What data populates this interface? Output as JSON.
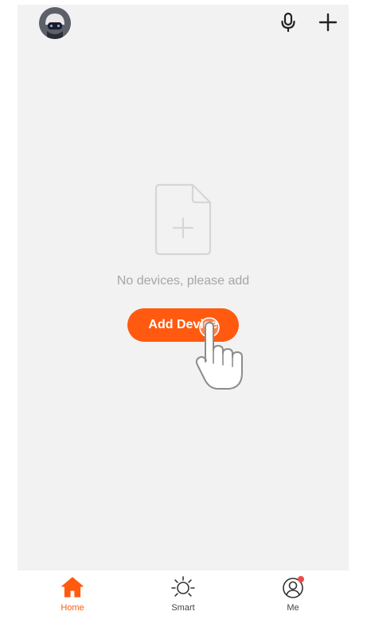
{
  "colors": {
    "accent": "#ff5a0f",
    "background": "#f2f2f2",
    "text_muted": "#a6a6a6",
    "badge": "#f04848"
  },
  "header": {
    "avatar_icon": "avatar-icon",
    "mic_icon": "microphone-icon",
    "add_icon": "plus-icon"
  },
  "empty_state": {
    "icon": "document-plus-icon",
    "message": "No devices, please add",
    "button_label": "Add Device",
    "pointer_icon": "hand-pointer-icon"
  },
  "tabbar": {
    "tabs": [
      {
        "label": "Home",
        "icon": "home-icon",
        "active": true
      },
      {
        "label": "Smart",
        "icon": "sun-icon",
        "active": false
      },
      {
        "label": "Me",
        "icon": "profile-icon",
        "active": false,
        "badge": true
      }
    ]
  }
}
